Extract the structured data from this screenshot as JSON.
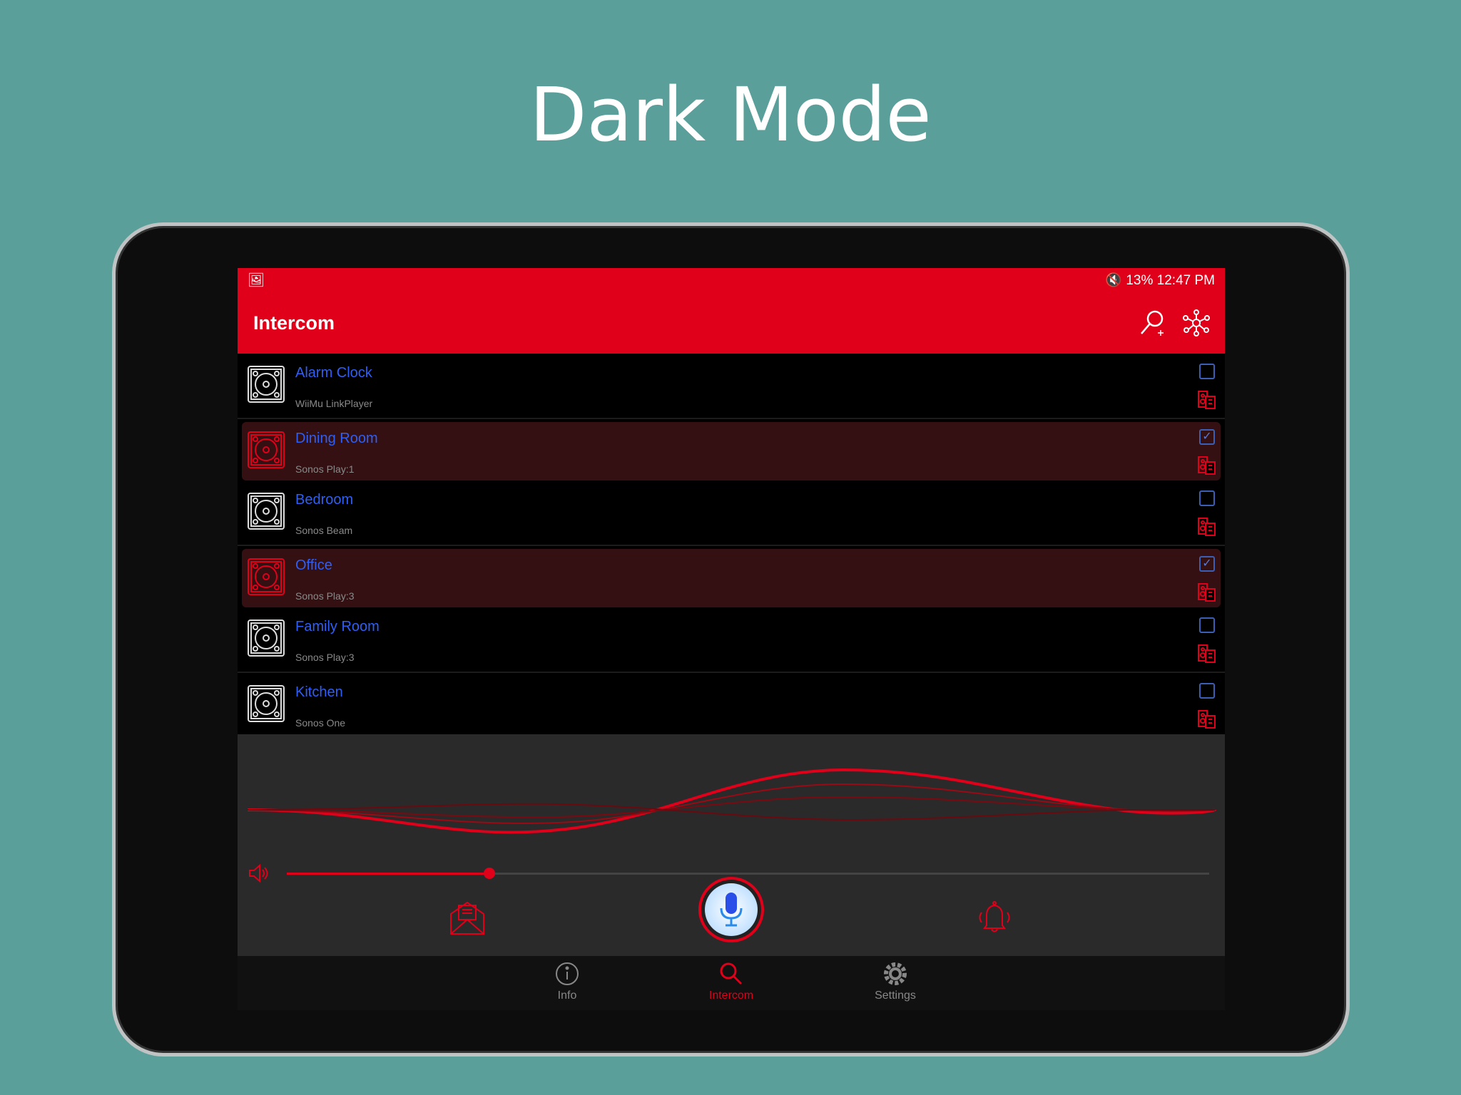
{
  "headline": "Dark Mode",
  "status_bar": {
    "battery": "13%",
    "time": "12:47 PM"
  },
  "toolbar": {
    "title": "Intercom",
    "icons": [
      "search-add-icon",
      "network-icon"
    ]
  },
  "devices": [
    {
      "name": "Alarm Clock",
      "model": "WiiMu LinkPlayer",
      "checked": false
    },
    {
      "name": "Dining Room",
      "model": "Sonos Play:1",
      "checked": true
    },
    {
      "name": "Bedroom",
      "model": "Sonos Beam",
      "checked": false
    },
    {
      "name": "Office",
      "model": "Sonos Play:3",
      "checked": true
    },
    {
      "name": "Family Room",
      "model": "Sonos Play:3",
      "checked": false
    },
    {
      "name": "Kitchen",
      "model": "Sonos One",
      "checked": false
    }
  ],
  "volume": {
    "percent": 22
  },
  "actions": [
    "message-icon",
    "microphone-icon",
    "bell-icon"
  ],
  "nav": [
    {
      "label": "Info",
      "icon": "info-icon"
    },
    {
      "label": "Intercom",
      "icon": "search-icon",
      "active": true
    },
    {
      "label": "Settings",
      "icon": "gear-icon"
    }
  ],
  "colors": {
    "accent": "#e0001a",
    "link": "#2f5ff5",
    "background": "#5a9f9a"
  }
}
